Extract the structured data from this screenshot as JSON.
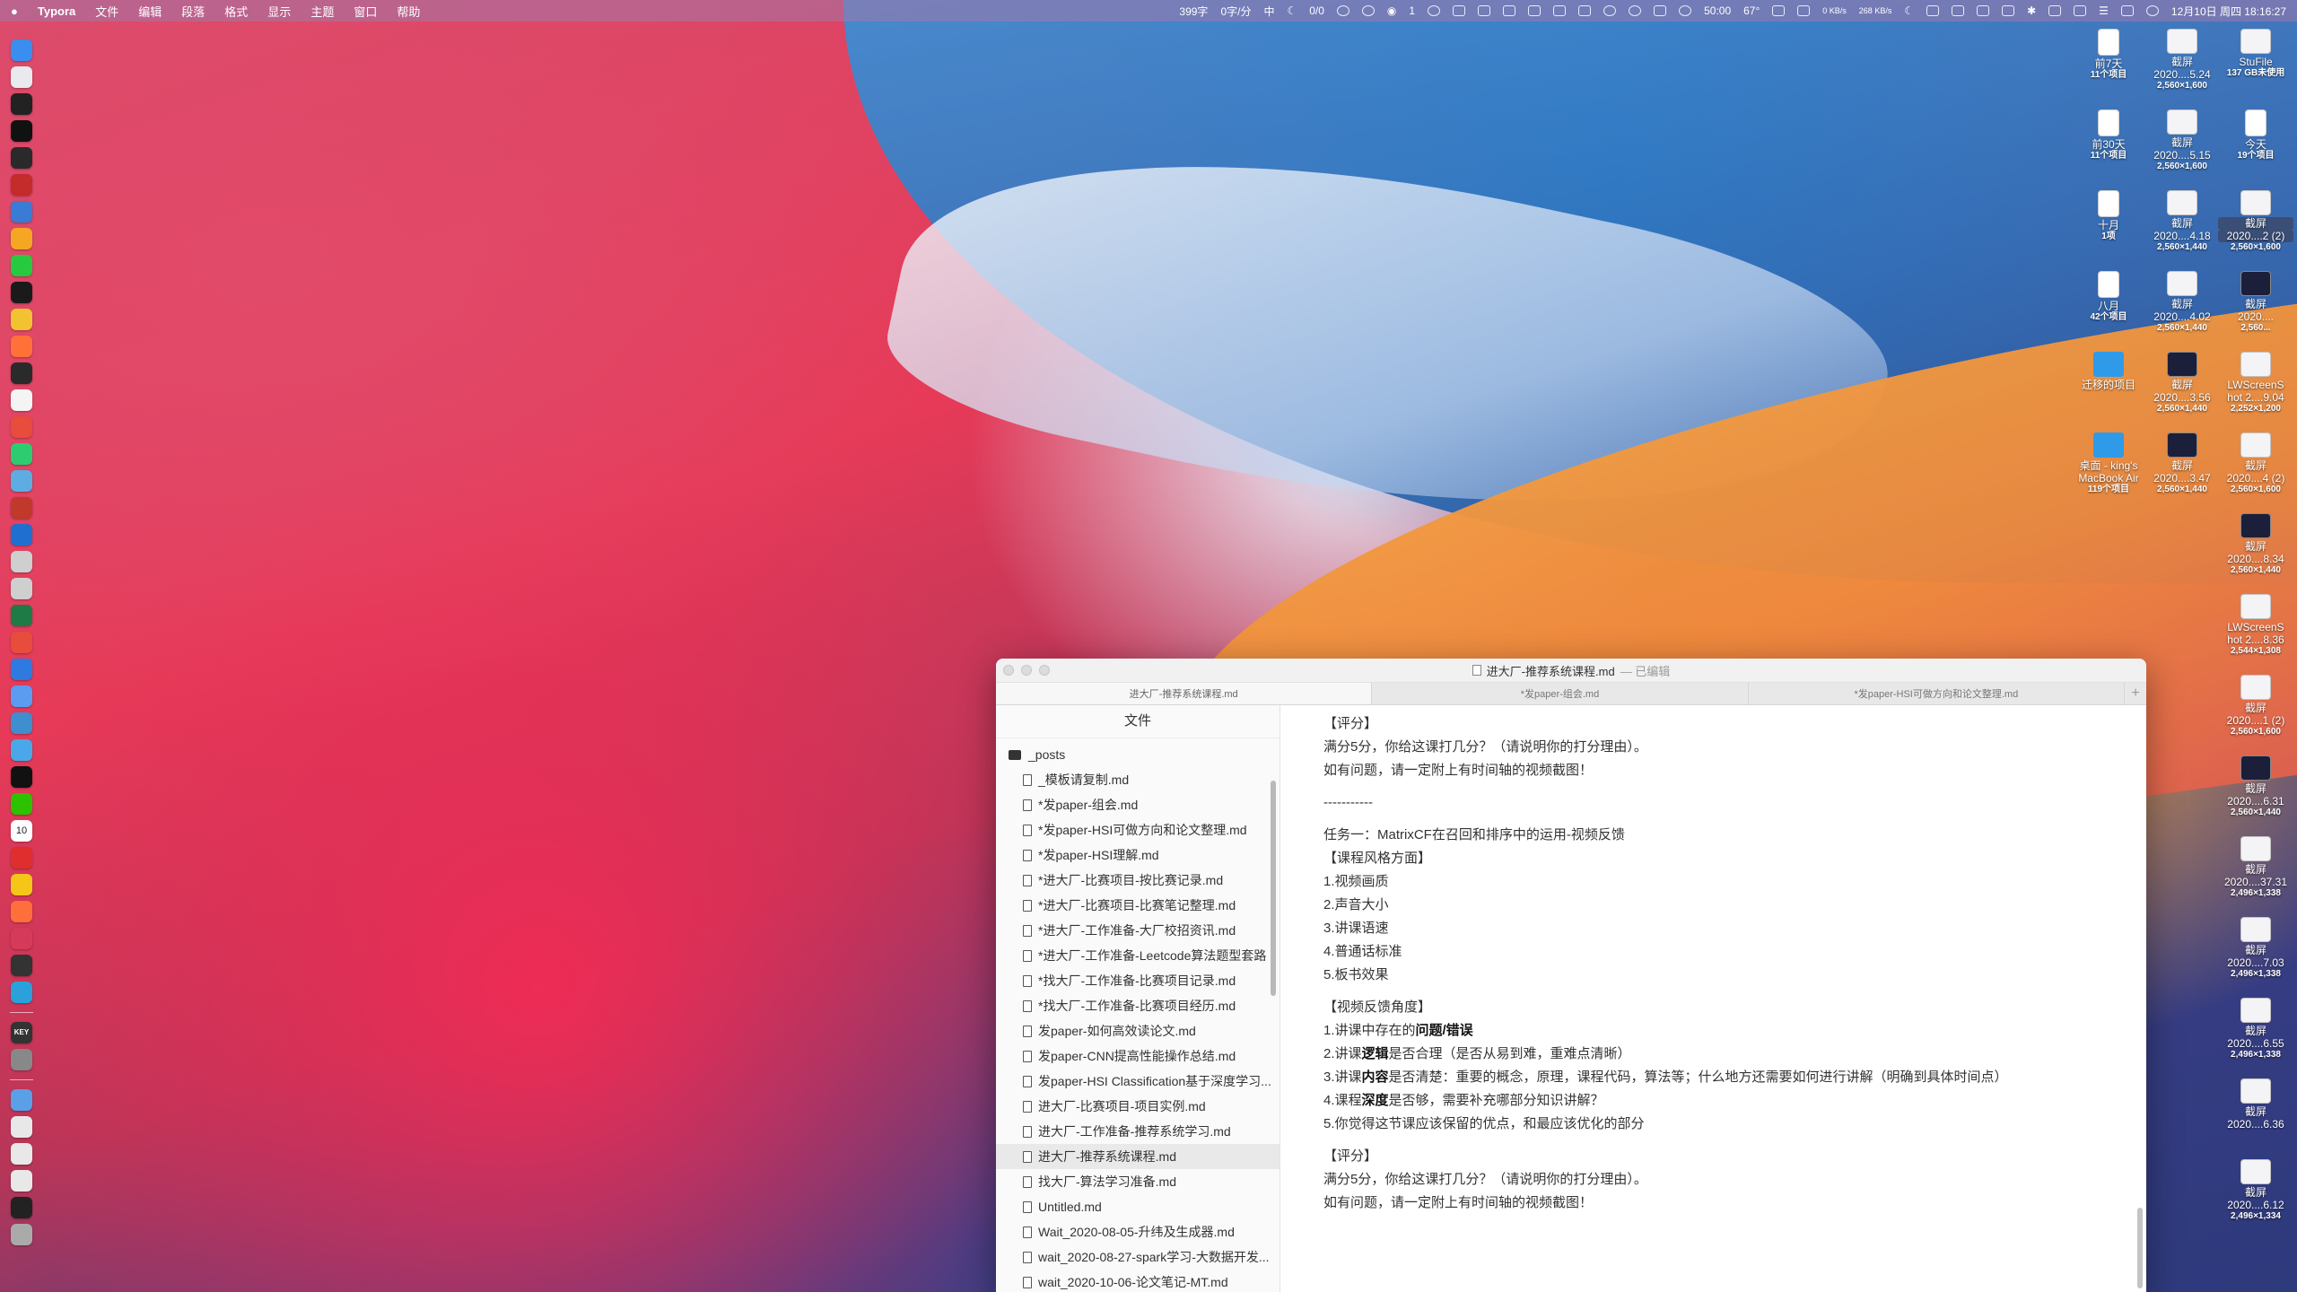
{
  "menubar": {
    "apple": "",
    "app_name": "Typora",
    "menus": [
      "文件",
      "编辑",
      "段落",
      "格式",
      "显示",
      "主题",
      "窗口",
      "帮助"
    ],
    "word_count": "399字",
    "char_count": "0字/分",
    "ime": "中",
    "counter": "0/0",
    "wechat_badge": "1",
    "timer": "50:00",
    "percent": "67°",
    "net_up": "0 KB/s",
    "net_down": "268 KB/s",
    "clock": "12月10日 周四 18:16:27"
  },
  "dock": {
    "apps": [
      "finder",
      "launchpad",
      "terminal",
      "iterm",
      "activity-monitor",
      "filezilla",
      "maps",
      "sublime",
      "pycharm",
      "circle-app",
      "chrome",
      "firefox",
      "spotify-like",
      "typora",
      "xmind",
      "mindnode",
      "baidu-netdisk",
      "red-app",
      "youdao",
      "help-1",
      "help-2",
      "excel",
      "pasty",
      "shazam",
      "preview",
      "mail",
      "calendar-doc",
      "qq",
      "wechat",
      "calendar",
      "netease-music",
      "photos",
      "pinwheel",
      "safari-block",
      "sound",
      "telegram",
      "keynote",
      "system-preferences",
      "screenshots",
      "mail-2",
      "preview-2",
      "preview-3",
      "terminal-2",
      "trash"
    ],
    "calendar_day": "10",
    "keynote_label": "KEY"
  },
  "desktop": {
    "icons": [
      {
        "name": "前7天",
        "sub": "11个项目",
        "kind": "doc"
      },
      {
        "name": "截屏",
        "name2": "2020....5.24",
        "sub": "2,560×1,600",
        "kind": "shot"
      },
      {
        "name": "StuFile",
        "sub": "137 GB未使用",
        "kind": "drive"
      },
      {
        "name": "前30天",
        "sub": "11个项目",
        "kind": "doc"
      },
      {
        "name": "截屏",
        "name2": "2020....5.15",
        "sub": "2,560×1,600",
        "kind": "shot"
      },
      {
        "name": "今天",
        "sub": "19个项目",
        "kind": "doc"
      },
      {
        "name": "十月",
        "sub": "1项",
        "kind": "doc"
      },
      {
        "name": "截屏",
        "name2": "2020....4.18",
        "sub": "2,560×1,440",
        "kind": "shot"
      },
      {
        "name": "截屏",
        "name2": "2020....2 (2)",
        "sub": "2,560×1,600",
        "kind": "shot"
      },
      {
        "name": "八月",
        "sub": "42个项目",
        "kind": "doc"
      },
      {
        "name": "截屏",
        "name2": "2020....4.02",
        "sub": "2,560×1,440",
        "kind": "shot"
      },
      {
        "name": "截屏",
        "name2": "2020....",
        "sub": "2,560...",
        "kind": "shot-dark"
      },
      {
        "name": "迁移的项目",
        "sub": "",
        "kind": "folder"
      },
      {
        "name": "截屏",
        "name2": "2020....3.56",
        "sub": "2,560×1,440",
        "kind": "shot-dark"
      },
      {
        "name": "LWScreenS",
        "name2": "hot 2....9.04",
        "sub": "2,252×1,200",
        "kind": "shot"
      },
      {
        "name": "桌面 - king's",
        "name2": "MacBook Air",
        "sub": "119个项目",
        "kind": "folder"
      },
      {
        "name": "截屏",
        "name2": "2020....3.47",
        "sub": "2,560×1,440",
        "kind": "shot-dark"
      },
      {
        "name": "截屏",
        "name2": "2020....4 (2)",
        "sub": "2,560×1,600",
        "kind": "shot"
      },
      {
        "name": "截屏",
        "name2": "2020....8.34",
        "sub": "2,560×1,440",
        "kind": "shot-dark"
      },
      {
        "name": "LWScreenS",
        "name2": "hot 2....8.36",
        "sub": "2,544×1,308",
        "kind": "shot"
      },
      {
        "name": "截屏",
        "name2": "2020....1 (2)",
        "sub": "2,560×1,600",
        "kind": "shot"
      },
      {
        "name": "截屏",
        "name2": "2020....6.31",
        "sub": "2,560×1,440",
        "kind": "shot-dark"
      },
      {
        "name": "截屏",
        "name2": "2020....37.31",
        "sub": "2,496×1,338",
        "kind": "shot"
      },
      {
        "name": "截屏",
        "name2": "2020....7.03",
        "sub": "2,496×1,338",
        "kind": "shot"
      },
      {
        "name": "截屏",
        "name2": "2020....6.55",
        "sub": "2,496×1,338",
        "kind": "shot"
      },
      {
        "name": "截屏",
        "name2": "2020....6.36",
        "sub": "",
        "kind": "shot"
      },
      {
        "name": "截屏",
        "name2": "2020....6.12",
        "sub": "2,496×1,334",
        "kind": "shot"
      }
    ]
  },
  "window": {
    "title": "进大厂-推荐系统课程.md",
    "title_suffix": "— 已编辑",
    "tabs": [
      "进大厂-推荐系统课程.md",
      "*发paper-组会.md",
      "*发paper-HSI可做方向和论文整理.md"
    ],
    "add_tab": "+",
    "sidebar_title": "文件",
    "folder": "_posts",
    "files": [
      "_模板请复制.md",
      "*发paper-组会.md",
      "*发paper-HSI可做方向和论文整理.md",
      "*发paper-HSI理解.md",
      "*进大厂-比赛项目-按比赛记录.md",
      "*进大厂-比赛项目-比赛笔记整理.md",
      "*进大厂-工作准备-大厂校招资讯.md",
      "*进大厂-工作准备-Leetcode算法题型套路",
      "*找大厂-工作准备-比赛项目记录.md",
      "*找大厂-工作准备-比赛项目经历.md",
      "发paper-如何高效读论文.md",
      "发paper-CNN提高性能操作总结.md",
      "发paper-HSI Classification基于深度学习...",
      "进大厂-比赛项目-项目实例.md",
      "进大厂-工作准备-推荐系统学习.md",
      "进大厂-推荐系统课程.md",
      "找大厂-算法学习准备.md",
      "Untitled.md",
      "Wait_2020-08-05-升纬及生成器.md",
      "wait_2020-08-27-spark学习-大数据开发...",
      "wait_2020-10-06-论文笔记-MT.md"
    ],
    "active_file_index": 15
  },
  "editor": {
    "l1": "【评分】",
    "l2": "满分5分，你给这课打几分？（请说明你的打分理由）。",
    "l3": "如有问题，请一定附上有时间轴的视频截图！",
    "l4": "-----------",
    "l5": "任务一：MatrixCF在召回和排序中的运用-视频反馈",
    "l6": "【课程风格方面】",
    "l7": "1.视频画质",
    "l8": "2.声音大小",
    "l9": "3.讲课语速",
    "l10": "4.普通话标准",
    "l11": "5.板书效果",
    "l12": "【视频反馈角度】",
    "l13a": "1.讲课中存在的",
    "l13b": "问题/错误",
    "l14a": "2.讲课",
    "l14b": "逻辑",
    "l14c": "是否合理（是否从易到难，重难点清晰）",
    "l15a": "3.讲课",
    "l15b": "内容",
    "l15c": "是否清楚：重要的概念，原理，课程代码，算法等；什么地方还需要如何进行讲解（明确到具体时间点）",
    "l16a": "4.课程",
    "l16b": "深度",
    "l16c": "是否够，需要补充哪部分知识讲解？",
    "l17": "5.你觉得这节课应该保留的优点，和最应该优化的部分",
    "l18": "【评分】",
    "l19": "满分5分，你给这课打几分？（请说明你的打分理由）。",
    "l20": "如有问题，请一定附上有时间轴的视频截图！"
  },
  "colors": {
    "dock_colors": [
      "#3a8ef0",
      "#e9e9ee",
      "#222",
      "#111",
      "#2a2a2a",
      "#c42b2b",
      "#3a7bd5",
      "#f5a623",
      "#27c93f",
      "#1a1a1a",
      "#f2c230",
      "#ff7139",
      "#2a2a2a",
      "#f4f4f4",
      "#e74c3c",
      "#2ecc71",
      "#5dade2",
      "#c0392b",
      "#1f6fd0",
      "#cfcfcf",
      "#cfcfcf",
      "#1e7b45",
      "#e74c3c",
      "#2d7be0",
      "#5b9cf0",
      "#3e8ed0",
      "#4aa8e8",
      "#111",
      "#2dc100",
      "#fff",
      "#e02e2e",
      "#f5c518",
      "#ff6f3c",
      "#d63a5a",
      "#333",
      "#2aa1da",
      "#333",
      "#888",
      "#5aa0e6",
      "#e8e8e8",
      "#e8e8e8",
      "#e8e8e8",
      "#222",
      "#aaa"
    ]
  }
}
